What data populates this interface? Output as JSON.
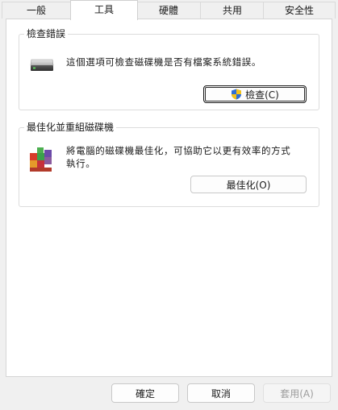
{
  "tabs": [
    {
      "label": "一般",
      "active": false
    },
    {
      "label": "工具",
      "active": true
    },
    {
      "label": "硬體",
      "active": false
    },
    {
      "label": "共用",
      "active": false
    },
    {
      "label": "安全性",
      "active": false
    }
  ],
  "error_check": {
    "title": "檢查錯誤",
    "description": "這個選項可檢查磁碟機是否有檔案系統錯誤。",
    "button_label": "檢查(C)",
    "icon": "drive-icon"
  },
  "optimize": {
    "title": "最佳化並重組磁碟機",
    "description": "將電腦的磁碟機最佳化，可協助它以更有效率的方式執行。",
    "button_label": "最佳化(O)",
    "icon": "defrag-icon"
  },
  "footer": {
    "ok_label": "確定",
    "cancel_label": "取消",
    "apply_label": "套用(A)"
  },
  "colors": {
    "panel_bg": "#ffffff",
    "window_bg": "#f0f0f0",
    "shield_blue": "#2f6fd6",
    "shield_yellow": "#f4c21a"
  }
}
